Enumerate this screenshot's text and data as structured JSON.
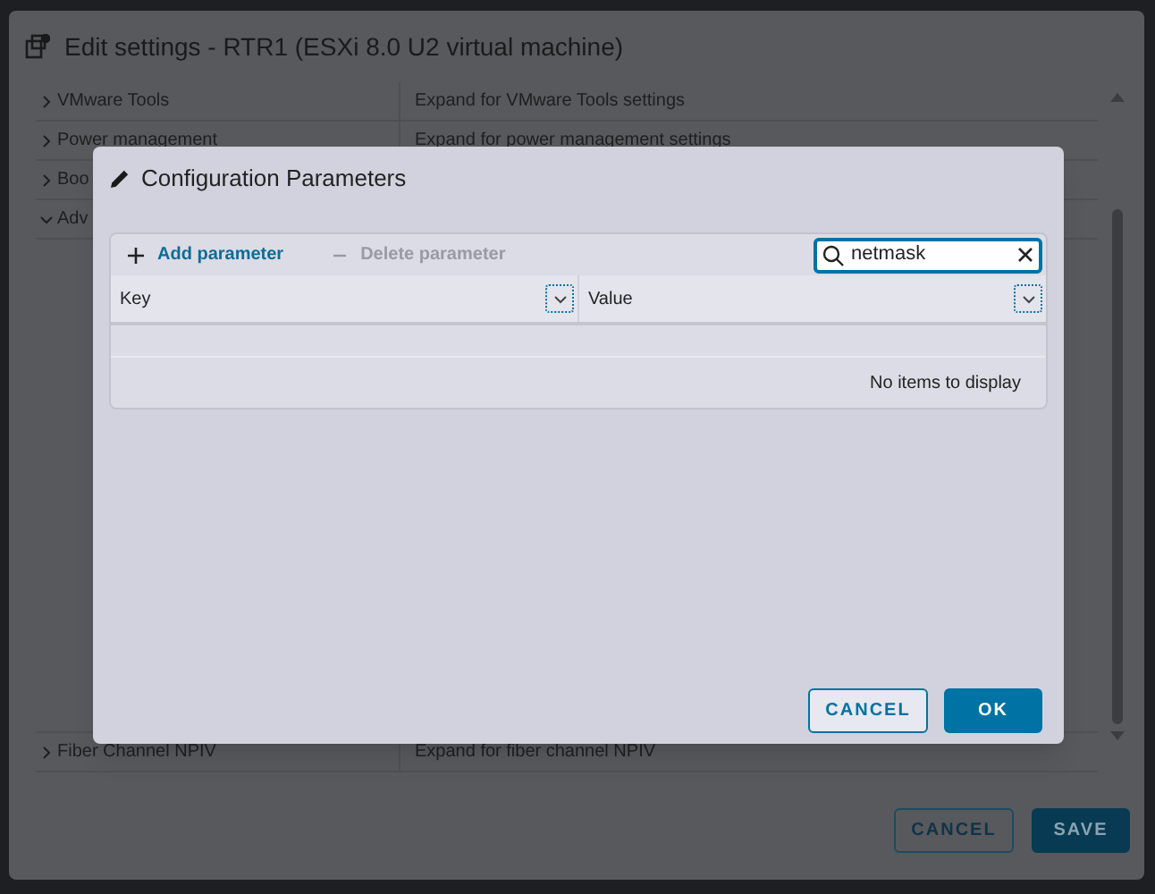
{
  "window": {
    "title": "Edit settings - RTR1 (ESXi 8.0 U2 virtual machine)"
  },
  "settings_rows": [
    {
      "label": "VMware Tools",
      "description": "Expand for VMware Tools settings",
      "expanded": false
    },
    {
      "label": "Power management",
      "description": "Expand for power management settings",
      "expanded": false
    },
    {
      "label": "Boo",
      "expanded": false
    },
    {
      "label": "Adv",
      "expanded": true
    }
  ],
  "settings_rows_bottom": [
    {
      "label": "Fiber Channel NPIV",
      "description": "Expand for fiber channel NPIV",
      "expanded": false
    }
  ],
  "footer_buttons": [
    {
      "label": "CANCEL",
      "kind": "outline"
    },
    {
      "label": "SAVE",
      "kind": "primary"
    }
  ],
  "dialog": {
    "title": "Configuration Parameters",
    "actions": [
      {
        "label": "Add parameter",
        "kind": "add",
        "disabled": false
      },
      {
        "label": "Delete parameter",
        "kind": "delete",
        "disabled": true
      }
    ],
    "search": {
      "value": "netmask"
    },
    "columns": [
      "Key",
      "Value"
    ],
    "empty_message": "No items to display",
    "buttons": [
      {
        "label": "CANCEL",
        "kind": "outline"
      },
      {
        "label": "OK",
        "kind": "primary"
      }
    ]
  }
}
